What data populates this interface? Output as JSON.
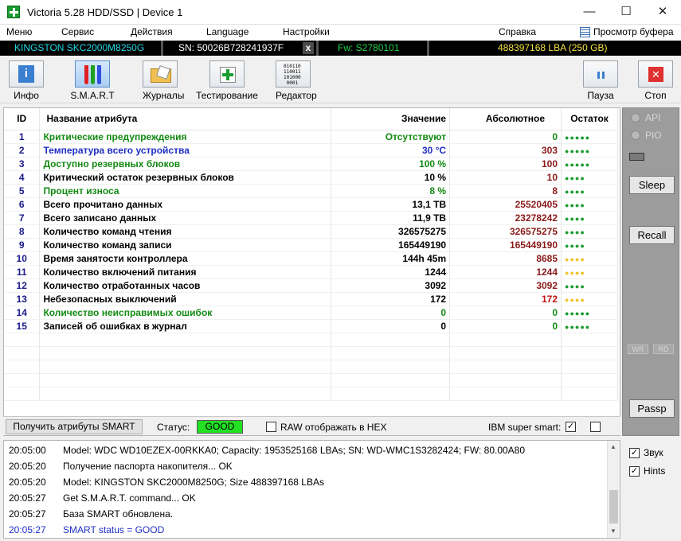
{
  "window": {
    "title": "Victoria 5.28 HDD/SSD | Device 1",
    "minimize": "—",
    "maximize": "☐",
    "close": "✕"
  },
  "menu": [
    "Меню",
    "Сервис",
    "Действия",
    "Language",
    "Настройки",
    "Справка",
    "Просмотр буфера"
  ],
  "device": {
    "model": "KINGSTON SKC2000M8250G",
    "serial": "SN: 50026B728241937F",
    "x_label": "x",
    "firmware": "Fw: S2780101",
    "capacity": "488397168 LBA (250 GB)"
  },
  "toolbar": {
    "info": "Инфо",
    "smart": "S.M.A.R.T",
    "logs": "Журналы",
    "testing": "Тестирование",
    "editor": "Редактор",
    "pause": "Пауза",
    "stop": "Стоп",
    "editor_glyph": "010110\n110011\n101000\n0001"
  },
  "table": {
    "headers": [
      "ID",
      "Название атрибута",
      "Значение",
      "Абсолютное",
      "Остаток"
    ],
    "rows": [
      {
        "id": "1",
        "name": "Критические предупреждения",
        "value": "Отсутствуют",
        "abs": "0",
        "rem": "●●●●●",
        "color": "green",
        "abscolor": "green",
        "dots": "g"
      },
      {
        "id": "2",
        "name": "Температура всего устройства",
        "value": "30 °C",
        "abs": "303",
        "rem": "●●●●●",
        "color": "blue",
        "abscolor": "red",
        "dots": "g"
      },
      {
        "id": "3",
        "name": "Доступно резервных блоков",
        "value": "100 %",
        "abs": "100",
        "rem": "●●●●●",
        "color": "green",
        "abscolor": "red",
        "dots": "g"
      },
      {
        "id": "4",
        "name": "Критический остаток резервных блоков",
        "value": "10 %",
        "abs": "10",
        "rem": "●●●●",
        "color": "black",
        "abscolor": "red",
        "dots": "g"
      },
      {
        "id": "5",
        "name": "Процент износа",
        "value": "8 %",
        "abs": "8",
        "rem": "●●●●",
        "color": "green",
        "abscolor": "red",
        "dots": "g"
      },
      {
        "id": "6",
        "name": "Всего прочитано данных",
        "value": "13,1 TB",
        "abs": "25520405",
        "rem": "●●●●",
        "color": "black",
        "abscolor": "red",
        "dots": "g"
      },
      {
        "id": "7",
        "name": "Всего записано данных",
        "value": "11,9 TB",
        "abs": "23278242",
        "rem": "●●●●",
        "color": "black",
        "abscolor": "red",
        "dots": "g"
      },
      {
        "id": "8",
        "name": "Количество команд чтения",
        "value": "326575275",
        "abs": "326575275",
        "rem": "●●●●",
        "color": "black",
        "abscolor": "red",
        "dots": "g"
      },
      {
        "id": "9",
        "name": "Количество команд записи",
        "value": "165449190",
        "abs": "165449190",
        "rem": "●●●●",
        "color": "black",
        "abscolor": "red",
        "dots": "g"
      },
      {
        "id": "10",
        "name": "Время занятости контроллера",
        "value": "144h 45m",
        "abs": "8685",
        "rem": "●●●●",
        "color": "black",
        "abscolor": "red",
        "dots": "y"
      },
      {
        "id": "11",
        "name": "Количество включений питания",
        "value": "1244",
        "abs": "1244",
        "rem": "●●●●",
        "color": "black",
        "abscolor": "red",
        "dots": "y"
      },
      {
        "id": "12",
        "name": "Количество отработанных часов",
        "value": "3092",
        "abs": "3092",
        "rem": "●●●●",
        "color": "black",
        "abscolor": "red",
        "dots": "g"
      },
      {
        "id": "13",
        "name": "Небезопасных выключений",
        "value": "172",
        "abs": "172",
        "rem": "●●●●",
        "color": "black",
        "abscolor": "brightred",
        "dots": "y"
      },
      {
        "id": "14",
        "name": "Количество неисправимых ошибок",
        "value": "0",
        "abs": "0",
        "rem": "●●●●●",
        "color": "green",
        "abscolor": "green",
        "dots": "g"
      },
      {
        "id": "15",
        "name": "Записей об ошибках в журнал",
        "value": "0",
        "abs": "0",
        "rem": "●●●●●",
        "color": "black",
        "abscolor": "green",
        "dots": "g"
      }
    ]
  },
  "status": {
    "get_button": "Получить атрибуты SMART",
    "status_label": "Статус:",
    "status_value": "GOOD",
    "raw_label": "RAW отображать в HEX",
    "ibm_label": "IBM super smart:",
    "ibm_check": "✓"
  },
  "right": {
    "api": "API",
    "pio": "PIO",
    "sleep": "Sleep",
    "recall": "Recall",
    "wr": "WR",
    "rd": "RD",
    "passp": "Passp"
  },
  "log": [
    {
      "time": "20:05:00",
      "text": "Model: WDC WD10EZEX-00RKKA0; Capacity: 1953525168 LBAs; SN: WD-WMC1S3282424; FW: 80.00A80"
    },
    {
      "time": "20:05:20",
      "text": "Получение паспорта накопителя... OK"
    },
    {
      "time": "20:05:20",
      "text": "Model: KINGSTON SKC2000M8250G; Size 488397168 LBAs"
    },
    {
      "time": "20:05:27",
      "text": "Get S.M.A.R.T. command... OK"
    },
    {
      "time": "20:05:27",
      "text": "База SMART обновлена."
    },
    {
      "time": "20:05:27",
      "text": "SMART status = GOOD"
    }
  ],
  "options": {
    "sound": "Звук",
    "hints": "Hints",
    "check": "✓"
  }
}
